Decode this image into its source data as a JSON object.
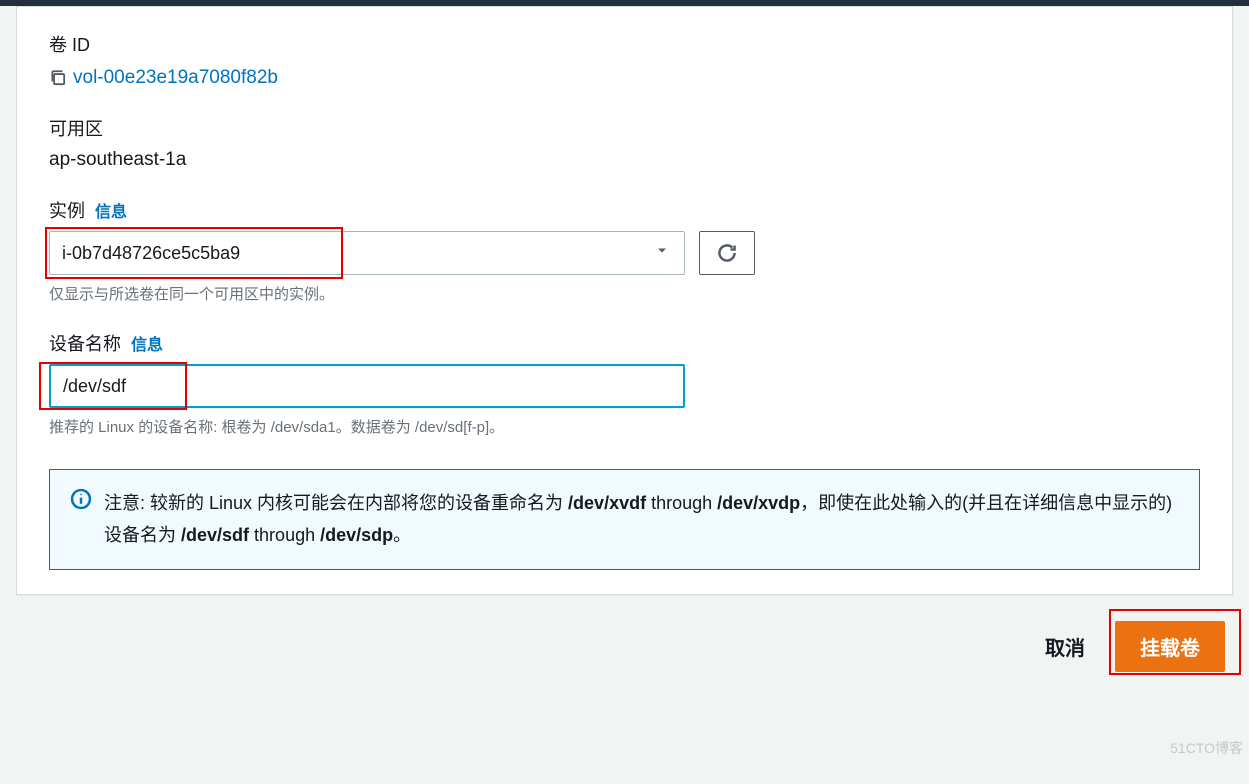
{
  "volume": {
    "label": "卷 ID",
    "id": "vol-00e23e19a7080f82b"
  },
  "az": {
    "label": "可用区",
    "value": "ap-southeast-1a"
  },
  "instance": {
    "label": "实例",
    "info": "信息",
    "selected": "i-0b7d48726ce5c5ba9",
    "helper": "仅显示与所选卷在同一个可用区中的实例。"
  },
  "device": {
    "label": "设备名称",
    "info": "信息",
    "value": "/dev/sdf",
    "helper": "推荐的 Linux 的设备名称: 根卷为 /dev/sda1。数据卷为 /dev/sd[f-p]。"
  },
  "alert": {
    "prefix": "注意: 较新的 Linux 内核可能会在内部将您的设备重命名为 ",
    "b1": "/dev/xvdf",
    "t1": " through ",
    "b2": "/dev/xvdp",
    "t2": "，即使在此处输入的(并且在详细信息中显示的)设备名为 ",
    "b3": "/dev/sdf",
    "t3": " through ",
    "b4": "/dev/sdp",
    "t4": "。"
  },
  "footer": {
    "cancel": "取消",
    "submit": "挂载卷"
  },
  "watermark": "51CTO博客"
}
